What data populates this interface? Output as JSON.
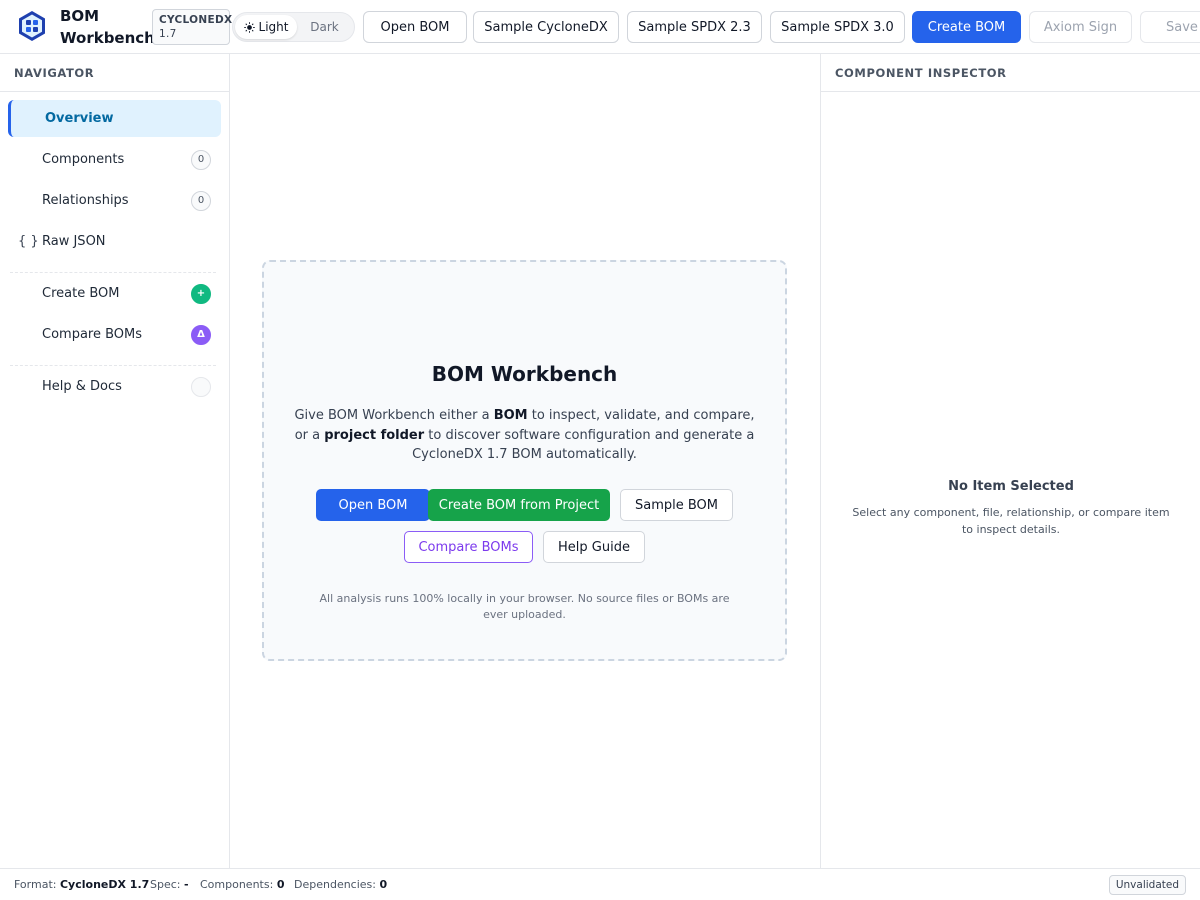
{
  "header": {
    "app_title_line1": "BOM",
    "app_title_line2": "Workbench",
    "spec_badge_name": "CYCLONEDX",
    "spec_badge_version": "1.7",
    "theme": {
      "light_label": "Light",
      "dark_label": "Dark",
      "selected": "light"
    },
    "buttons": {
      "open_bom": "Open BOM",
      "sample_cyclonedx": "Sample CycloneDX",
      "sample_spdx_23": "Sample SPDX 2.3",
      "sample_spdx_30": "Sample SPDX 3.0",
      "create_bom": "Create BOM",
      "axiom_sign": "Axiom Sign",
      "save": "Save A"
    }
  },
  "sidebar": {
    "title": "NAVIGATOR",
    "items": [
      {
        "label": "Overview",
        "active": true
      },
      {
        "label": "Components",
        "count": "0"
      },
      {
        "label": "Relationships",
        "count": "0"
      },
      {
        "label": "Raw JSON",
        "icon": "{ }"
      },
      {
        "label": "Create BOM",
        "badge": "+"
      },
      {
        "label": "Compare BOMs",
        "badge": "Δ"
      },
      {
        "label": "Help & Docs"
      }
    ]
  },
  "main": {
    "title": "BOM Workbench",
    "desc_part1": "Give BOM Workbench either a ",
    "desc_bold1": "BOM",
    "desc_part2": " to inspect, validate, and compare, or a ",
    "desc_bold2": "project folder",
    "desc_part3": " to discover software configuration and generate a CycloneDX 1.7 BOM automatically.",
    "buttons": {
      "open_bom": "Open BOM",
      "create_from_project": "Create BOM from Project",
      "sample_bom": "Sample BOM",
      "compare_boms": "Compare BOMs",
      "help_guide": "Help Guide"
    },
    "note": "All analysis runs 100% locally in your browser. No source files or BOMs are ever uploaded."
  },
  "inspector": {
    "title": "COMPONENT INSPECTOR",
    "empty_title": "No Item Selected",
    "empty_desc": "Select any component, file, relationship, or compare item to inspect details."
  },
  "statusbar": {
    "format_label": "Format:",
    "format_value": "CycloneDX 1.7",
    "spec_label": "Spec:",
    "spec_value": "-",
    "components_label": "Components:",
    "components_value": "0",
    "dependencies_label": "Dependencies:",
    "dependencies_value": "0",
    "validation_status": "Unvalidated"
  },
  "colors": {
    "primary": "#2563eb",
    "success": "#16a34a",
    "accent_purple": "#8b5cf6",
    "active_nav_bg": "#e0f2fe"
  }
}
